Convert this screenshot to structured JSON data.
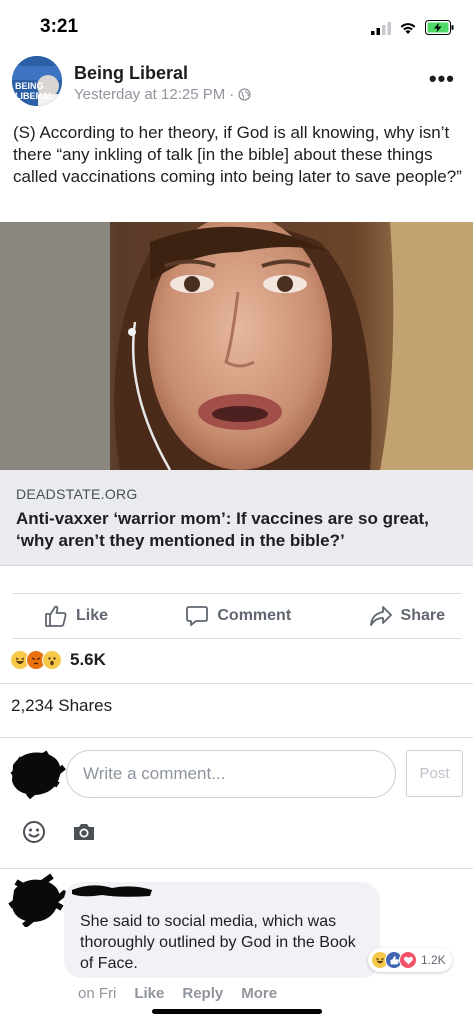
{
  "status_bar": {
    "time": "3:21"
  },
  "post": {
    "page_name": "Being Liberal",
    "timestamp": "Yesterday at 12:25 PM",
    "separator": "·",
    "avatar_text": [
      "BEING",
      "LIBERAL"
    ],
    "text": "(S) According to her theory, if God is all knowing, why isn’t there “any inkling of talk [in the bible] about these things called vaccinations coming into being later to save people?”",
    "more_label": "•••"
  },
  "link": {
    "domain": "DEADSTATE.ORG",
    "title": "Anti-vaxxer ‘warrior mom’: If vaccines are so great, ‘why aren’t they mentioned in the bible?’"
  },
  "actions": {
    "like": "Like",
    "comment": "Comment",
    "share": "Share"
  },
  "reactions": {
    "icons": [
      "haha",
      "angry",
      "wow"
    ],
    "count": "5.6K"
  },
  "shares": "2,234 Shares",
  "comment_box": {
    "placeholder": "Write a comment...",
    "post_label": "Post"
  },
  "comment": {
    "text": "She said to social media, which was thoroughly outlined by God in the Book of Face.",
    "reaction_icons": [
      "haha",
      "like",
      "love"
    ],
    "reaction_count": "1.2K",
    "time": "on Fri",
    "like": "Like",
    "reply": "Reply",
    "more": "More"
  },
  "colors": {
    "facebook_blue": "#4267b2",
    "haha_yellow": "#f7c94a",
    "angry_orange": "#e9710f",
    "love_red": "#f25268"
  }
}
